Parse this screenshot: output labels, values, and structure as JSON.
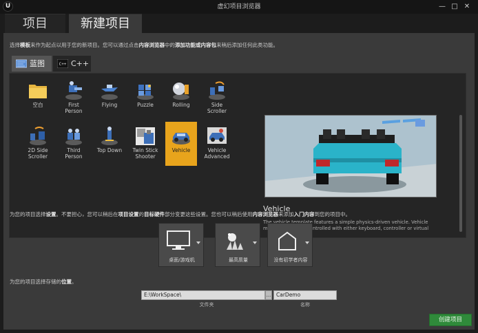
{
  "window": {
    "logo": "U",
    "title": "虚幻项目浏览器",
    "minimize_glyph": "—",
    "maximize_glyph": "□",
    "close_glyph": "✕"
  },
  "tabs": [
    {
      "label": "项目",
      "active": false
    },
    {
      "label": "新建项目",
      "active": true
    }
  ],
  "intro": {
    "t1": "选择",
    "b1": "模板",
    "t2": "来作为起点以用于您的新项目。您可以通过点击",
    "b2": "内容浏览器",
    "t3": "中的",
    "b3": "添加功能或内容包",
    "t4": "来稍后添加任何此类功能。"
  },
  "subtabs": [
    {
      "label": "蓝图",
      "icon": "blueprint-icon",
      "active": true
    },
    {
      "label": "C++",
      "icon": "cpp-icon",
      "active": false
    }
  ],
  "templates": [
    {
      "label": "空白",
      "icon": "blank-folder-icon",
      "selected": false
    },
    {
      "label": "First\nPerson",
      "icon": "first-person-icon",
      "selected": false
    },
    {
      "label": "Flying",
      "icon": "flying-icon",
      "selected": false
    },
    {
      "label": "Puzzle",
      "icon": "puzzle-icon",
      "selected": false
    },
    {
      "label": "Rolling",
      "icon": "rolling-icon",
      "selected": false
    },
    {
      "label": "Side\nScroller",
      "icon": "side-scroller-icon",
      "selected": false
    },
    {
      "label": "2D Side\nScroller",
      "icon": "2d-side-scroller-icon",
      "selected": false
    },
    {
      "label": "Third\nPerson",
      "icon": "third-person-icon",
      "selected": false
    },
    {
      "label": "Top Down",
      "icon": "top-down-icon",
      "selected": false
    },
    {
      "label": "Twin Stick\nShooter",
      "icon": "twin-stick-shooter-icon",
      "selected": false
    },
    {
      "label": "Vehicle",
      "icon": "vehicle-icon",
      "selected": true
    },
    {
      "label": "Vehicle\nAdvanced",
      "icon": "vehicle-advanced-icon",
      "selected": false
    }
  ],
  "preview": {
    "title": "Vehicle",
    "description": "The vehicle template features a simple physics-driven vehicle. Vehicle movement can be controlled with either keyboard, controller or virtual joystick on a touch"
  },
  "settings_text": {
    "t1": "为您的项目选择",
    "b1": "设置",
    "t2": "。不要担心，您可以稍后在",
    "b2": "项目设置",
    "t3": "的",
    "b3": "目标硬件",
    "t4": "部分变更这些设置。您也可以稍后使用",
    "b4": "内容浏览器",
    "t5": "来添加",
    "b5": "入门内容",
    "t6": "到您的项目中。"
  },
  "settings": [
    {
      "label": "桌面/游戏机",
      "icon": "monitor-icon"
    },
    {
      "label": "最高质量",
      "icon": "quality-sparkle-icon"
    },
    {
      "label": "没有初学者内容",
      "icon": "empty-box-icon"
    }
  ],
  "location_text": {
    "t1": "为您的项目选择存储的",
    "b1": "位置",
    "t2": "。"
  },
  "location": {
    "folder": "E:\\WorkSpace\\",
    "folder_browse": "...",
    "folder_caption": "文件夹",
    "name": "CarDemo",
    "name_caption": "名称"
  },
  "create_button": "创建项目",
  "colors": {
    "accent_selected": "#e8a41c",
    "create_green": "#2f8a3a",
    "car_body": "#2ab3c9"
  }
}
